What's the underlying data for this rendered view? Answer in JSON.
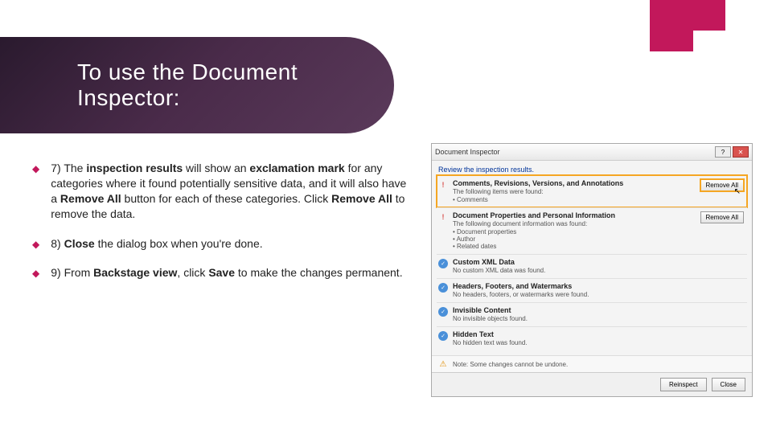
{
  "title": "To use the Document Inspector:",
  "bullets": [
    {
      "html": "7) The <b>inspection results</b> will show an <b>exclamation mark</b> for any categories where it found potentially sensitive data, and it will also have a <b>Remove All</b> button for each of these categories. Click <b>Remove All</b> to remove the data."
    },
    {
      "html": "8) <b>Close</b> the dialog box when you're done."
    },
    {
      "html": "9) From <b>Backstage view</b>, click <b>Save</b> to make the changes permanent."
    }
  ],
  "dialog": {
    "title": "Document Inspector",
    "instruction": "Review the inspection results.",
    "rows": [
      {
        "id": "comments",
        "status": "warn",
        "highlighted": true,
        "title": "Comments, Revisions, Versions, and Annotations",
        "desc": "The following items were found:",
        "items": [
          "Comments"
        ],
        "remove_all": true,
        "remove_hl": true
      },
      {
        "id": "docprops",
        "status": "warn",
        "highlighted": false,
        "title": "Document Properties and Personal Information",
        "desc": "The following document information was found:",
        "items": [
          "Document properties",
          "Author",
          "Related dates"
        ],
        "remove_all": true,
        "remove_hl": false
      },
      {
        "id": "xml",
        "status": "ok",
        "title": "Custom XML Data",
        "desc": "No custom XML data was found."
      },
      {
        "id": "headers",
        "status": "ok",
        "title": "Headers, Footers, and Watermarks",
        "desc": "No headers, footers, or watermarks were found."
      },
      {
        "id": "invisible",
        "status": "ok",
        "title": "Invisible Content",
        "desc": "No invisible objects found."
      },
      {
        "id": "hidden",
        "status": "ok",
        "title": "Hidden Text",
        "desc": "No hidden text was found."
      }
    ],
    "note": "Note: Some changes cannot be undone.",
    "buttons": {
      "reinspect": "Reinspect",
      "close": "Close"
    },
    "remove_all_label": "Remove All"
  }
}
